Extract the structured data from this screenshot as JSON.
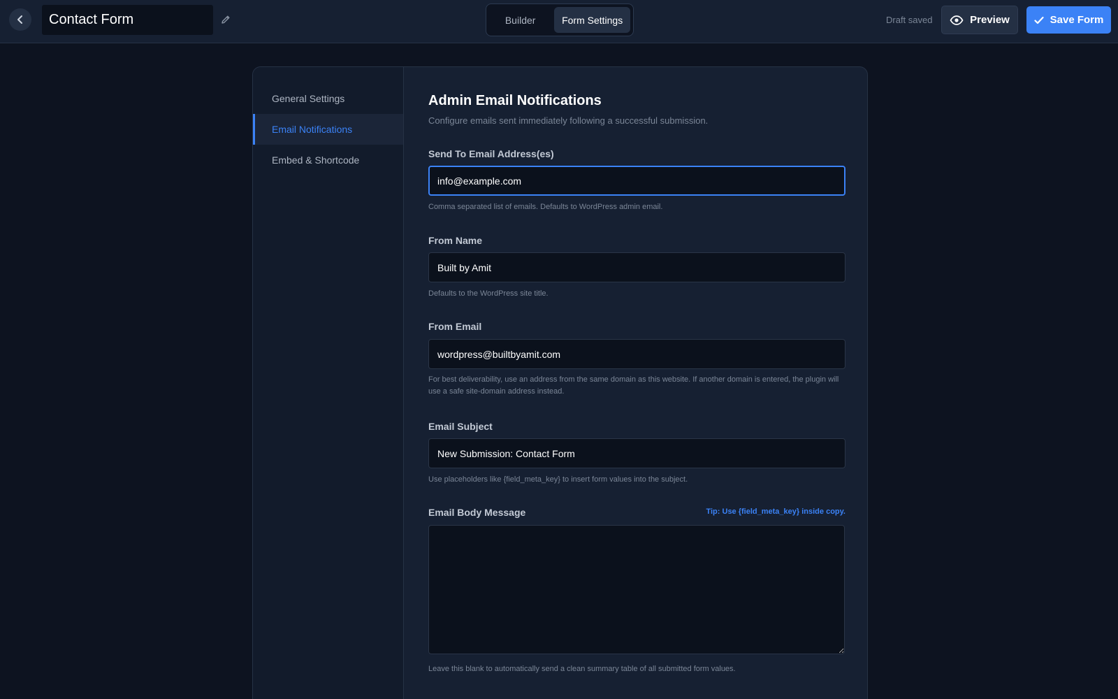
{
  "header": {
    "form_title": "Contact Form",
    "tabs": [
      {
        "label": "Builder",
        "active": false
      },
      {
        "label": "Form Settings",
        "active": true
      }
    ],
    "draft_status": "Draft saved",
    "preview_label": "Preview",
    "save_label": "Save Form",
    "icons": {
      "back": "chevron-left-icon",
      "edit": "pencil-icon",
      "preview": "eye-icon",
      "save": "check-icon"
    }
  },
  "sidebar": {
    "items": [
      {
        "label": "General Settings",
        "active": false
      },
      {
        "label": "Email Notifications",
        "active": true
      },
      {
        "label": "Embed & Shortcode",
        "active": false
      }
    ]
  },
  "main": {
    "title": "Admin Email Notifications",
    "description": "Configure emails sent immediately following a successful submission.",
    "fields": {
      "send_to": {
        "label": "Send To Email Address(es)",
        "value": "info@example.com",
        "help": "Comma separated list of emails. Defaults to WordPress admin email."
      },
      "from_name": {
        "label": "From Name",
        "value": "Built by Amit",
        "help": "Defaults to the WordPress site title."
      },
      "from_email": {
        "label": "From Email",
        "value": "wordpress@builtbyamit.com",
        "help": "For best deliverability, use an address from the same domain as this website. If another domain is entered, the plugin will use a safe site-domain address instead."
      },
      "subject": {
        "label": "Email Subject",
        "value": "New Submission: Contact Form",
        "help": "Use placeholders like {field_meta_key} to insert form values into the subject."
      },
      "body": {
        "label": "Email Body Message",
        "tip": "Tip: Use {field_meta_key} inside copy.",
        "value": "",
        "help": "Leave this blank to automatically send a clean summary table of all submitted form values."
      }
    }
  },
  "colors": {
    "background": "#0d1320",
    "panel": "#162032",
    "accent": "#3b82f6",
    "input_bg": "#0b111c"
  }
}
